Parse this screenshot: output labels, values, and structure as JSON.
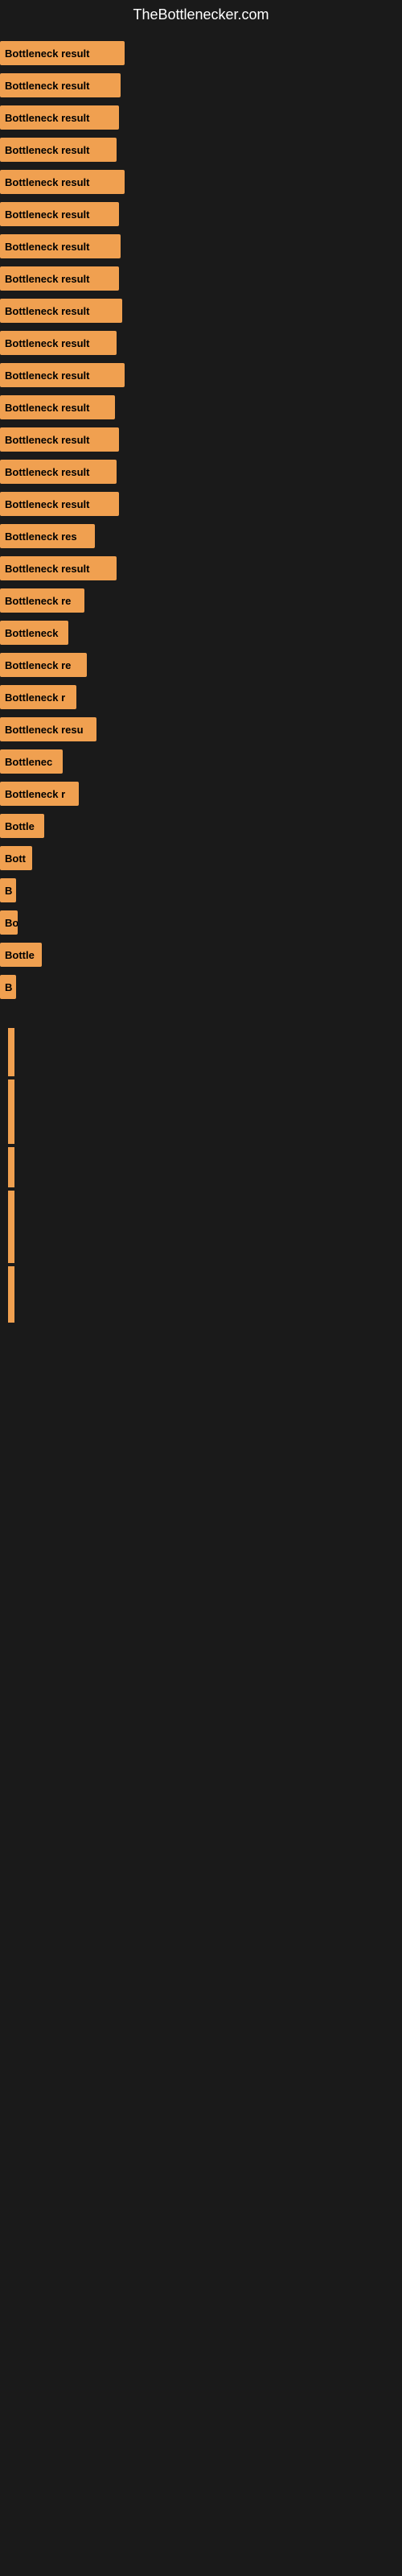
{
  "site": {
    "title": "TheBottlenecker.com"
  },
  "bars": [
    {
      "label": "Bottleneck result",
      "width": 155,
      "height": 30
    },
    {
      "label": "Bottleneck result",
      "width": 150,
      "height": 30
    },
    {
      "label": "Bottleneck result",
      "width": 148,
      "height": 30
    },
    {
      "label": "Bottleneck result",
      "width": 145,
      "height": 30
    },
    {
      "label": "Bottleneck result",
      "width": 155,
      "height": 30
    },
    {
      "label": "Bottleneck result",
      "width": 148,
      "height": 30
    },
    {
      "label": "Bottleneck result",
      "width": 150,
      "height": 30
    },
    {
      "label": "Bottleneck result",
      "width": 148,
      "height": 30
    },
    {
      "label": "Bottleneck result",
      "width": 152,
      "height": 30
    },
    {
      "label": "Bottleneck result",
      "width": 145,
      "height": 30
    },
    {
      "label": "Bottleneck result",
      "width": 155,
      "height": 30
    },
    {
      "label": "Bottleneck result",
      "width": 143,
      "height": 30
    },
    {
      "label": "Bottleneck result",
      "width": 148,
      "height": 30
    },
    {
      "label": "Bottleneck result",
      "width": 145,
      "height": 30
    },
    {
      "label": "Bottleneck result",
      "width": 148,
      "height": 30
    },
    {
      "label": "Bottleneck res",
      "width": 118,
      "height": 30
    },
    {
      "label": "Bottleneck result",
      "width": 145,
      "height": 30
    },
    {
      "label": "Bottleneck re",
      "width": 105,
      "height": 30
    },
    {
      "label": "Bottleneck",
      "width": 85,
      "height": 30
    },
    {
      "label": "Bottleneck re",
      "width": 108,
      "height": 30
    },
    {
      "label": "Bottleneck r",
      "width": 95,
      "height": 30
    },
    {
      "label": "Bottleneck resu",
      "width": 120,
      "height": 30
    },
    {
      "label": "Bottlenec",
      "width": 78,
      "height": 30
    },
    {
      "label": "Bottleneck r",
      "width": 98,
      "height": 30
    },
    {
      "label": "Bottle",
      "width": 55,
      "height": 30
    },
    {
      "label": "Bott",
      "width": 40,
      "height": 30
    },
    {
      "label": "B",
      "width": 18,
      "height": 30
    },
    {
      "label": "Bo",
      "width": 22,
      "height": 30
    },
    {
      "label": "Bottle",
      "width": 52,
      "height": 30
    },
    {
      "label": "B",
      "width": 14,
      "height": 30
    }
  ],
  "vertical_bars": [
    {
      "height": 60
    },
    {
      "height": 80
    },
    {
      "height": 50
    },
    {
      "height": 90
    },
    {
      "height": 70
    }
  ],
  "colors": {
    "bar_fill": "#f0a050",
    "background": "#1a1a1a",
    "title_text": "#ffffff",
    "bar_text": "#000000"
  }
}
